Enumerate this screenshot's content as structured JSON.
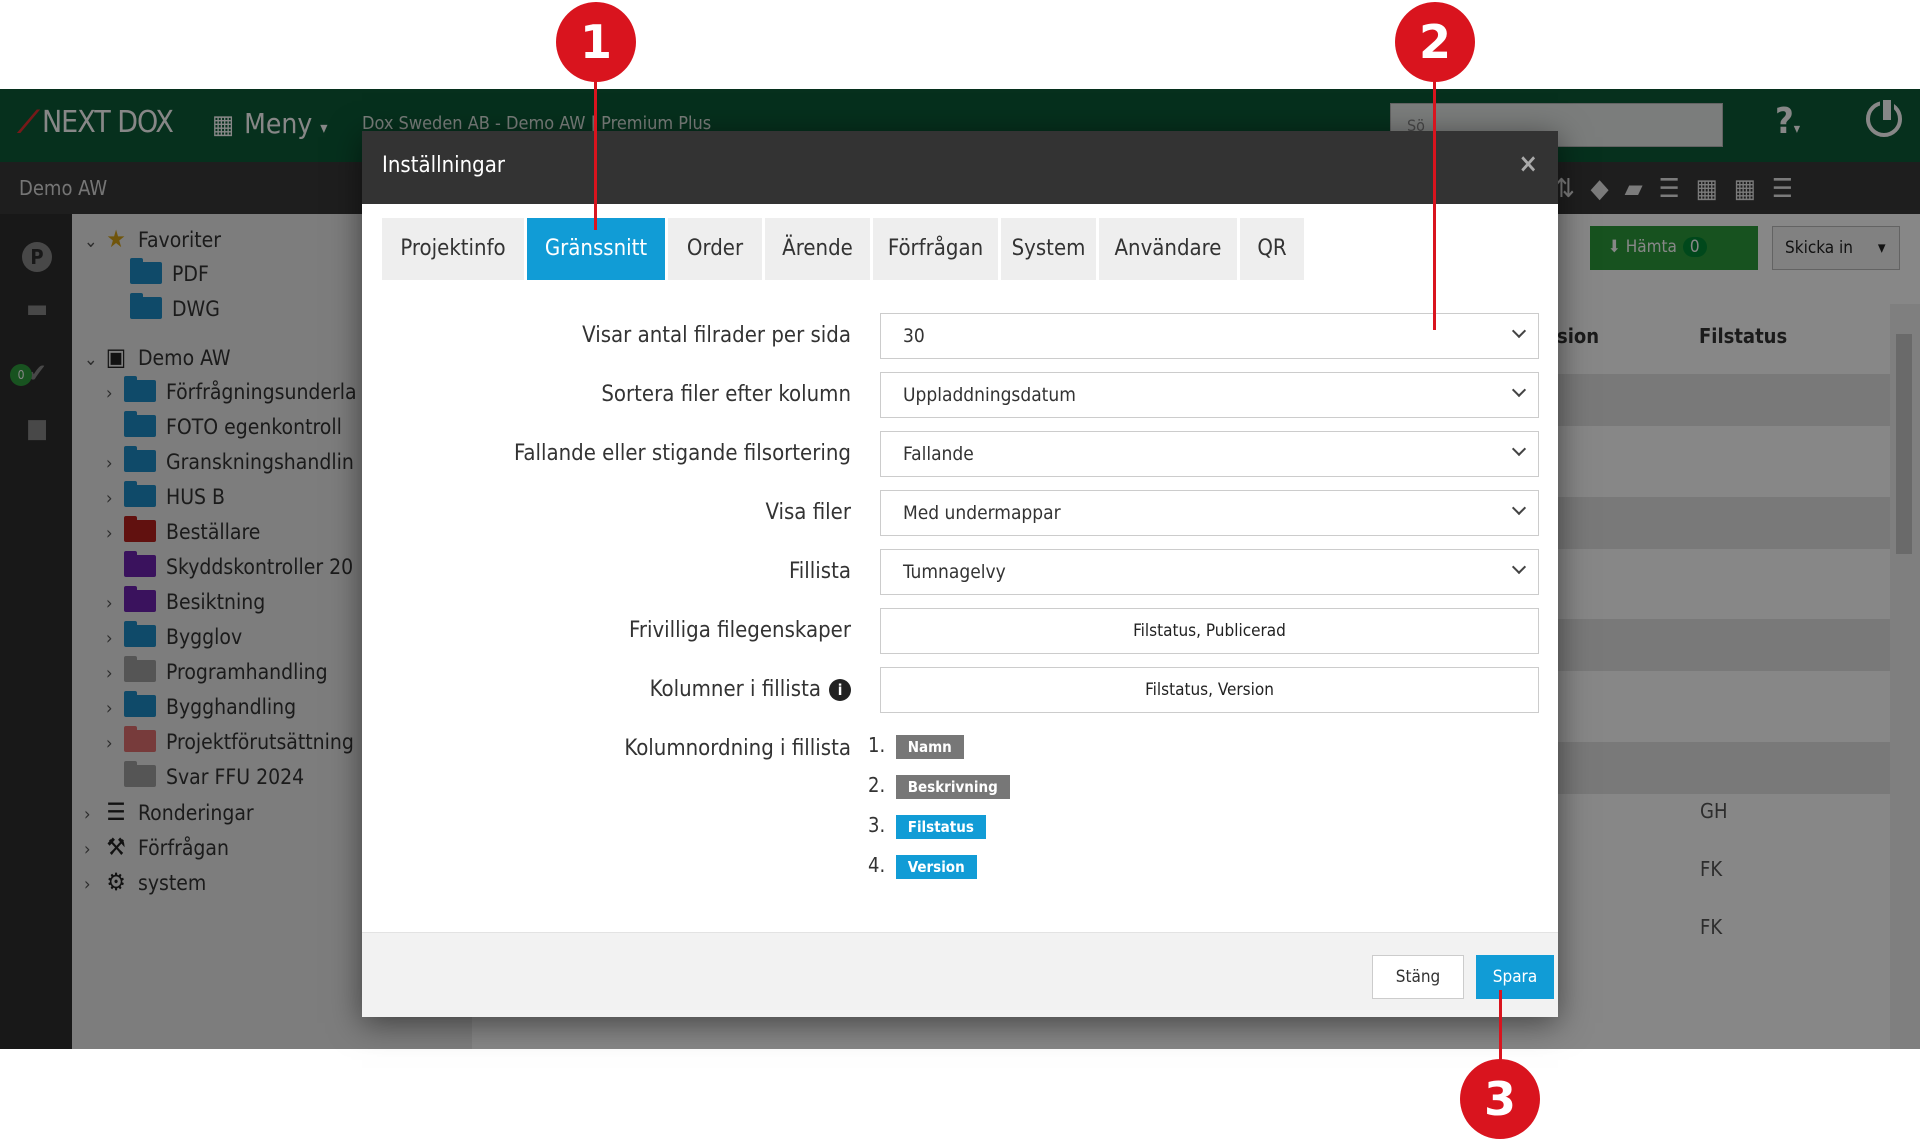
{
  "app": {
    "logo": "NEXT DOX",
    "menu_label": "Meny",
    "breadcrumb": "Dox Sweden AB - Demo AW | Premium Plus",
    "search_placeholder": "Sö",
    "help_label": "?",
    "project_name": "Demo AW"
  },
  "toolbar": {
    "hamta_label": "Hämta",
    "hamta_count": "0",
    "skicka_label": "Skicka in"
  },
  "sidebar": {
    "favorites_label": "Favoriter",
    "favorites": [
      "PDF",
      "DWG"
    ],
    "project_label": "Demo AW",
    "folders": [
      "Förfrågningsunderla",
      "FOTO egenkontroll",
      "Granskningshandlin",
      "HUS B",
      "Beställare",
      "Skyddskontroller 20",
      "Besiktning",
      "Bygglov",
      "Programhandling",
      "Bygghandling",
      "Projektförutsättning",
      "Svar FFU 2024"
    ],
    "rond_label": "Ronderingar",
    "forfragan_label": "Förfrågan",
    "system_label": "system",
    "rail_badge": "0"
  },
  "main_table": {
    "col_version": "sion",
    "col_filstatus": "Filstatus",
    "status_values": [
      "GH",
      "FK",
      "FK"
    ]
  },
  "modal": {
    "title": "Inställningar",
    "close": "×",
    "tabs": [
      "Projektinfo",
      "Gränssnitt",
      "Order",
      "Ärende",
      "Förfrågan",
      "System",
      "Användare",
      "QR"
    ],
    "active_tab": "Gränssnitt",
    "rows": [
      {
        "label": "Visar antal filrader per sida",
        "value": "30"
      },
      {
        "label": "Sortera filer efter kolumn",
        "value": "Uppladdningsdatum"
      },
      {
        "label": "Fallande eller stigande filsortering",
        "value": "Fallande"
      },
      {
        "label": "Visa filer",
        "value": "Med undermappar"
      },
      {
        "label": "Fillista",
        "value": "Tumnagelvy"
      }
    ],
    "optional_label": "Frivilliga filegenskaper",
    "optional_value": "Filstatus, Publicerad",
    "columns_label": "Kolumner i fillista",
    "columns_value": "Filstatus, Version",
    "order_label": "Kolumnordning i fillista",
    "order_items": [
      {
        "num": "1.",
        "label": "Namn"
      },
      {
        "num": "2.",
        "label": "Beskrivning"
      },
      {
        "num": "3.",
        "label": "Filstatus"
      },
      {
        "num": "4.",
        "label": "Version"
      }
    ],
    "close_button": "Stäng",
    "save_button": "Spara"
  },
  "callouts": [
    "1",
    "2",
    "3"
  ],
  "colors": {
    "topbar": "#0d5c38",
    "accent": "#119cd6",
    "callout": "#d9141e",
    "success": "#2d9c3c"
  }
}
